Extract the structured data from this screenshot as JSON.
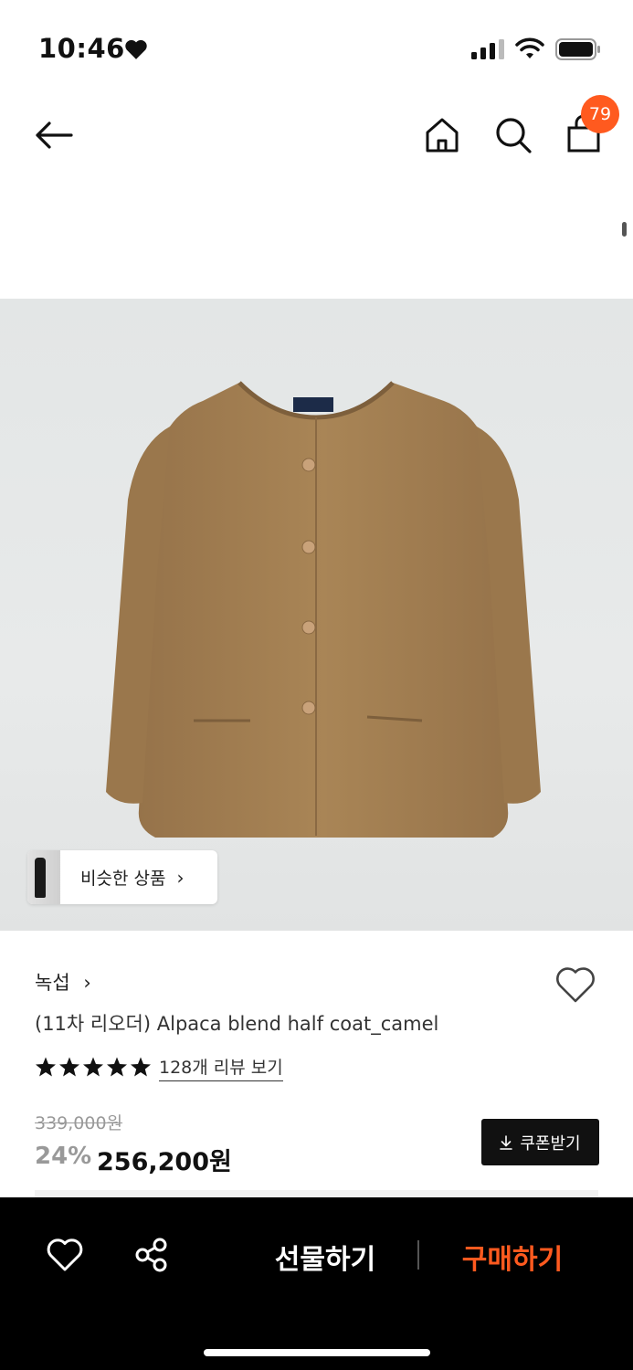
{
  "status_bar": {
    "time": "10:46",
    "icons": [
      "heart-icon",
      "cellular-signal-icon",
      "wifi-icon",
      "battery-icon"
    ]
  },
  "nav": {
    "back_icon": "arrow-left-icon",
    "home_icon": "home-icon",
    "search_icon": "search-icon",
    "cart_icon": "shopping-bag-icon",
    "cart_count": "79"
  },
  "product": {
    "similar_label": "비슷한 상품",
    "brand": "녹섭",
    "title": "(11차 리오더) Alpaca blend half coat_camel",
    "rating_stars": 5,
    "review_link": "128개 리뷰 보기",
    "original_price": "339,000원",
    "discount": "24%",
    "final_price": "256,200원",
    "coupon_label": "쿠폰받기",
    "image_color": "#a98556"
  },
  "bottom_bar": {
    "gift_label": "선물하기",
    "buy_label": "구매하기",
    "accent": "#ff5a1f"
  }
}
